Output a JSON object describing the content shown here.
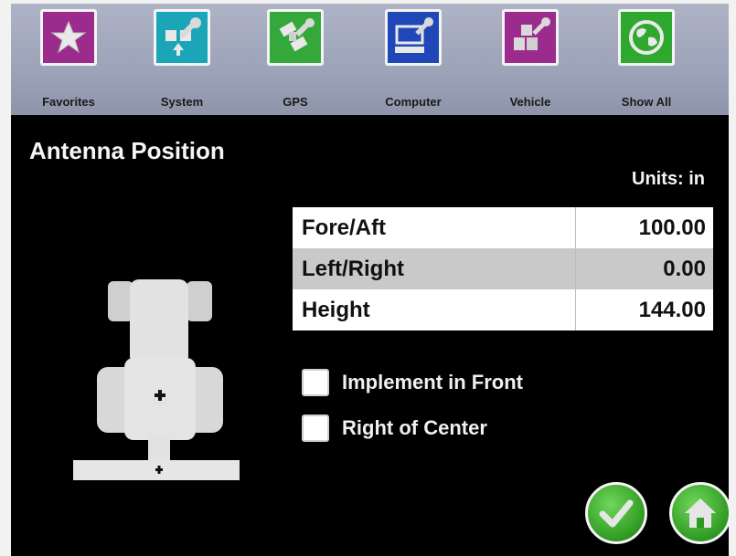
{
  "toolbar": {
    "items": [
      {
        "label": "Favorites",
        "icon": "star-icon",
        "color": "#9b2c8e"
      },
      {
        "label": "System",
        "icon": "system-wrench-icon",
        "color": "#1aa6b7"
      },
      {
        "label": "GPS",
        "icon": "gps-satellite-icon",
        "color": "#34a83a"
      },
      {
        "label": "Computer",
        "icon": "computer-icon",
        "color": "#1f47b8"
      },
      {
        "label": "Vehicle",
        "icon": "vehicle-blocks-icon",
        "color": "#9b2c8e"
      },
      {
        "label": "Show All",
        "icon": "globe-icon",
        "color": "#2ea82f"
      }
    ]
  },
  "page": {
    "title": "Antenna Position",
    "units_label": "Units: in"
  },
  "table": {
    "rows": [
      {
        "label": "Fore/Aft",
        "value": "100.00"
      },
      {
        "label": "Left/Right",
        "value": "0.00"
      },
      {
        "label": "Height",
        "value": "144.00"
      }
    ]
  },
  "options": {
    "implement_in_front": {
      "label": "Implement in Front",
      "checked": false
    },
    "right_of_center": {
      "label": "Right of Center",
      "checked": false
    }
  },
  "actions": {
    "confirm_icon": "checkmark-icon",
    "home_icon": "home-icon"
  }
}
